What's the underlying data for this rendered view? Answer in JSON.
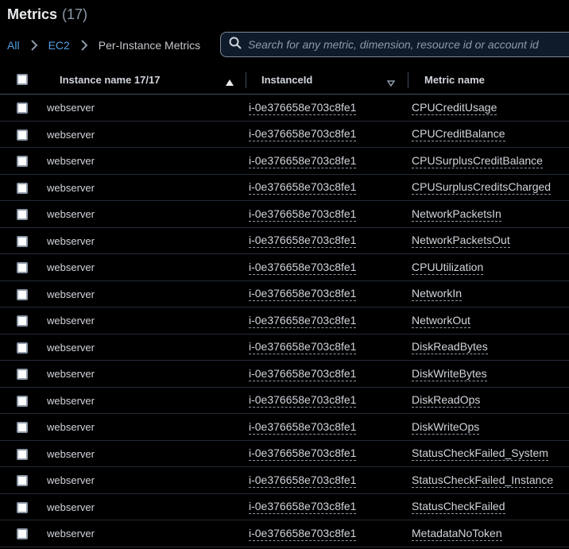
{
  "header": {
    "title": "Metrics",
    "count": "(17)"
  },
  "breadcrumb": {
    "all": "All",
    "ec2": "EC2",
    "current": "Per-Instance Metrics"
  },
  "search": {
    "placeholder": "Search for any metric, dimension, resource id or account id",
    "value": ""
  },
  "columns": {
    "instance_name": "Instance name 17/17",
    "instance_id": "InstanceId",
    "metric_name": "Metric name"
  },
  "rows": [
    {
      "instance_name": "webserver",
      "instance_id": "i-0e376658e703c8fe1",
      "metric_name": "CPUCreditUsage"
    },
    {
      "instance_name": "webserver",
      "instance_id": "i-0e376658e703c8fe1",
      "metric_name": "CPUCreditBalance"
    },
    {
      "instance_name": "webserver",
      "instance_id": "i-0e376658e703c8fe1",
      "metric_name": "CPUSurplusCreditBalance"
    },
    {
      "instance_name": "webserver",
      "instance_id": "i-0e376658e703c8fe1",
      "metric_name": "CPUSurplusCreditsCharged"
    },
    {
      "instance_name": "webserver",
      "instance_id": "i-0e376658e703c8fe1",
      "metric_name": "NetworkPacketsIn"
    },
    {
      "instance_name": "webserver",
      "instance_id": "i-0e376658e703c8fe1",
      "metric_name": "NetworkPacketsOut"
    },
    {
      "instance_name": "webserver",
      "instance_id": "i-0e376658e703c8fe1",
      "metric_name": "CPUUtilization"
    },
    {
      "instance_name": "webserver",
      "instance_id": "i-0e376658e703c8fe1",
      "metric_name": "NetworkIn"
    },
    {
      "instance_name": "webserver",
      "instance_id": "i-0e376658e703c8fe1",
      "metric_name": "NetworkOut"
    },
    {
      "instance_name": "webserver",
      "instance_id": "i-0e376658e703c8fe1",
      "metric_name": "DiskReadBytes"
    },
    {
      "instance_name": "webserver",
      "instance_id": "i-0e376658e703c8fe1",
      "metric_name": "DiskWriteBytes"
    },
    {
      "instance_name": "webserver",
      "instance_id": "i-0e376658e703c8fe1",
      "metric_name": "DiskReadOps"
    },
    {
      "instance_name": "webserver",
      "instance_id": "i-0e376658e703c8fe1",
      "metric_name": "DiskWriteOps"
    },
    {
      "instance_name": "webserver",
      "instance_id": "i-0e376658e703c8fe1",
      "metric_name": "StatusCheckFailed_System"
    },
    {
      "instance_name": "webserver",
      "instance_id": "i-0e376658e703c8fe1",
      "metric_name": "StatusCheckFailed_Instance"
    },
    {
      "instance_name": "webserver",
      "instance_id": "i-0e376658e703c8fe1",
      "metric_name": "StatusCheckFailed"
    },
    {
      "instance_name": "webserver",
      "instance_id": "i-0e376658e703c8fe1",
      "metric_name": "MetadataNoToken"
    }
  ],
  "icons": {
    "search": "search-icon",
    "sort_asc": "sort-ascending-icon",
    "sort_desc": "sort-descending-icon",
    "breadcrumb_separator": "chevron-right-icon"
  },
  "colors": {
    "background": "#000000",
    "link": "#539fe5",
    "text": "#d1d5db",
    "border": "#414d5c"
  }
}
